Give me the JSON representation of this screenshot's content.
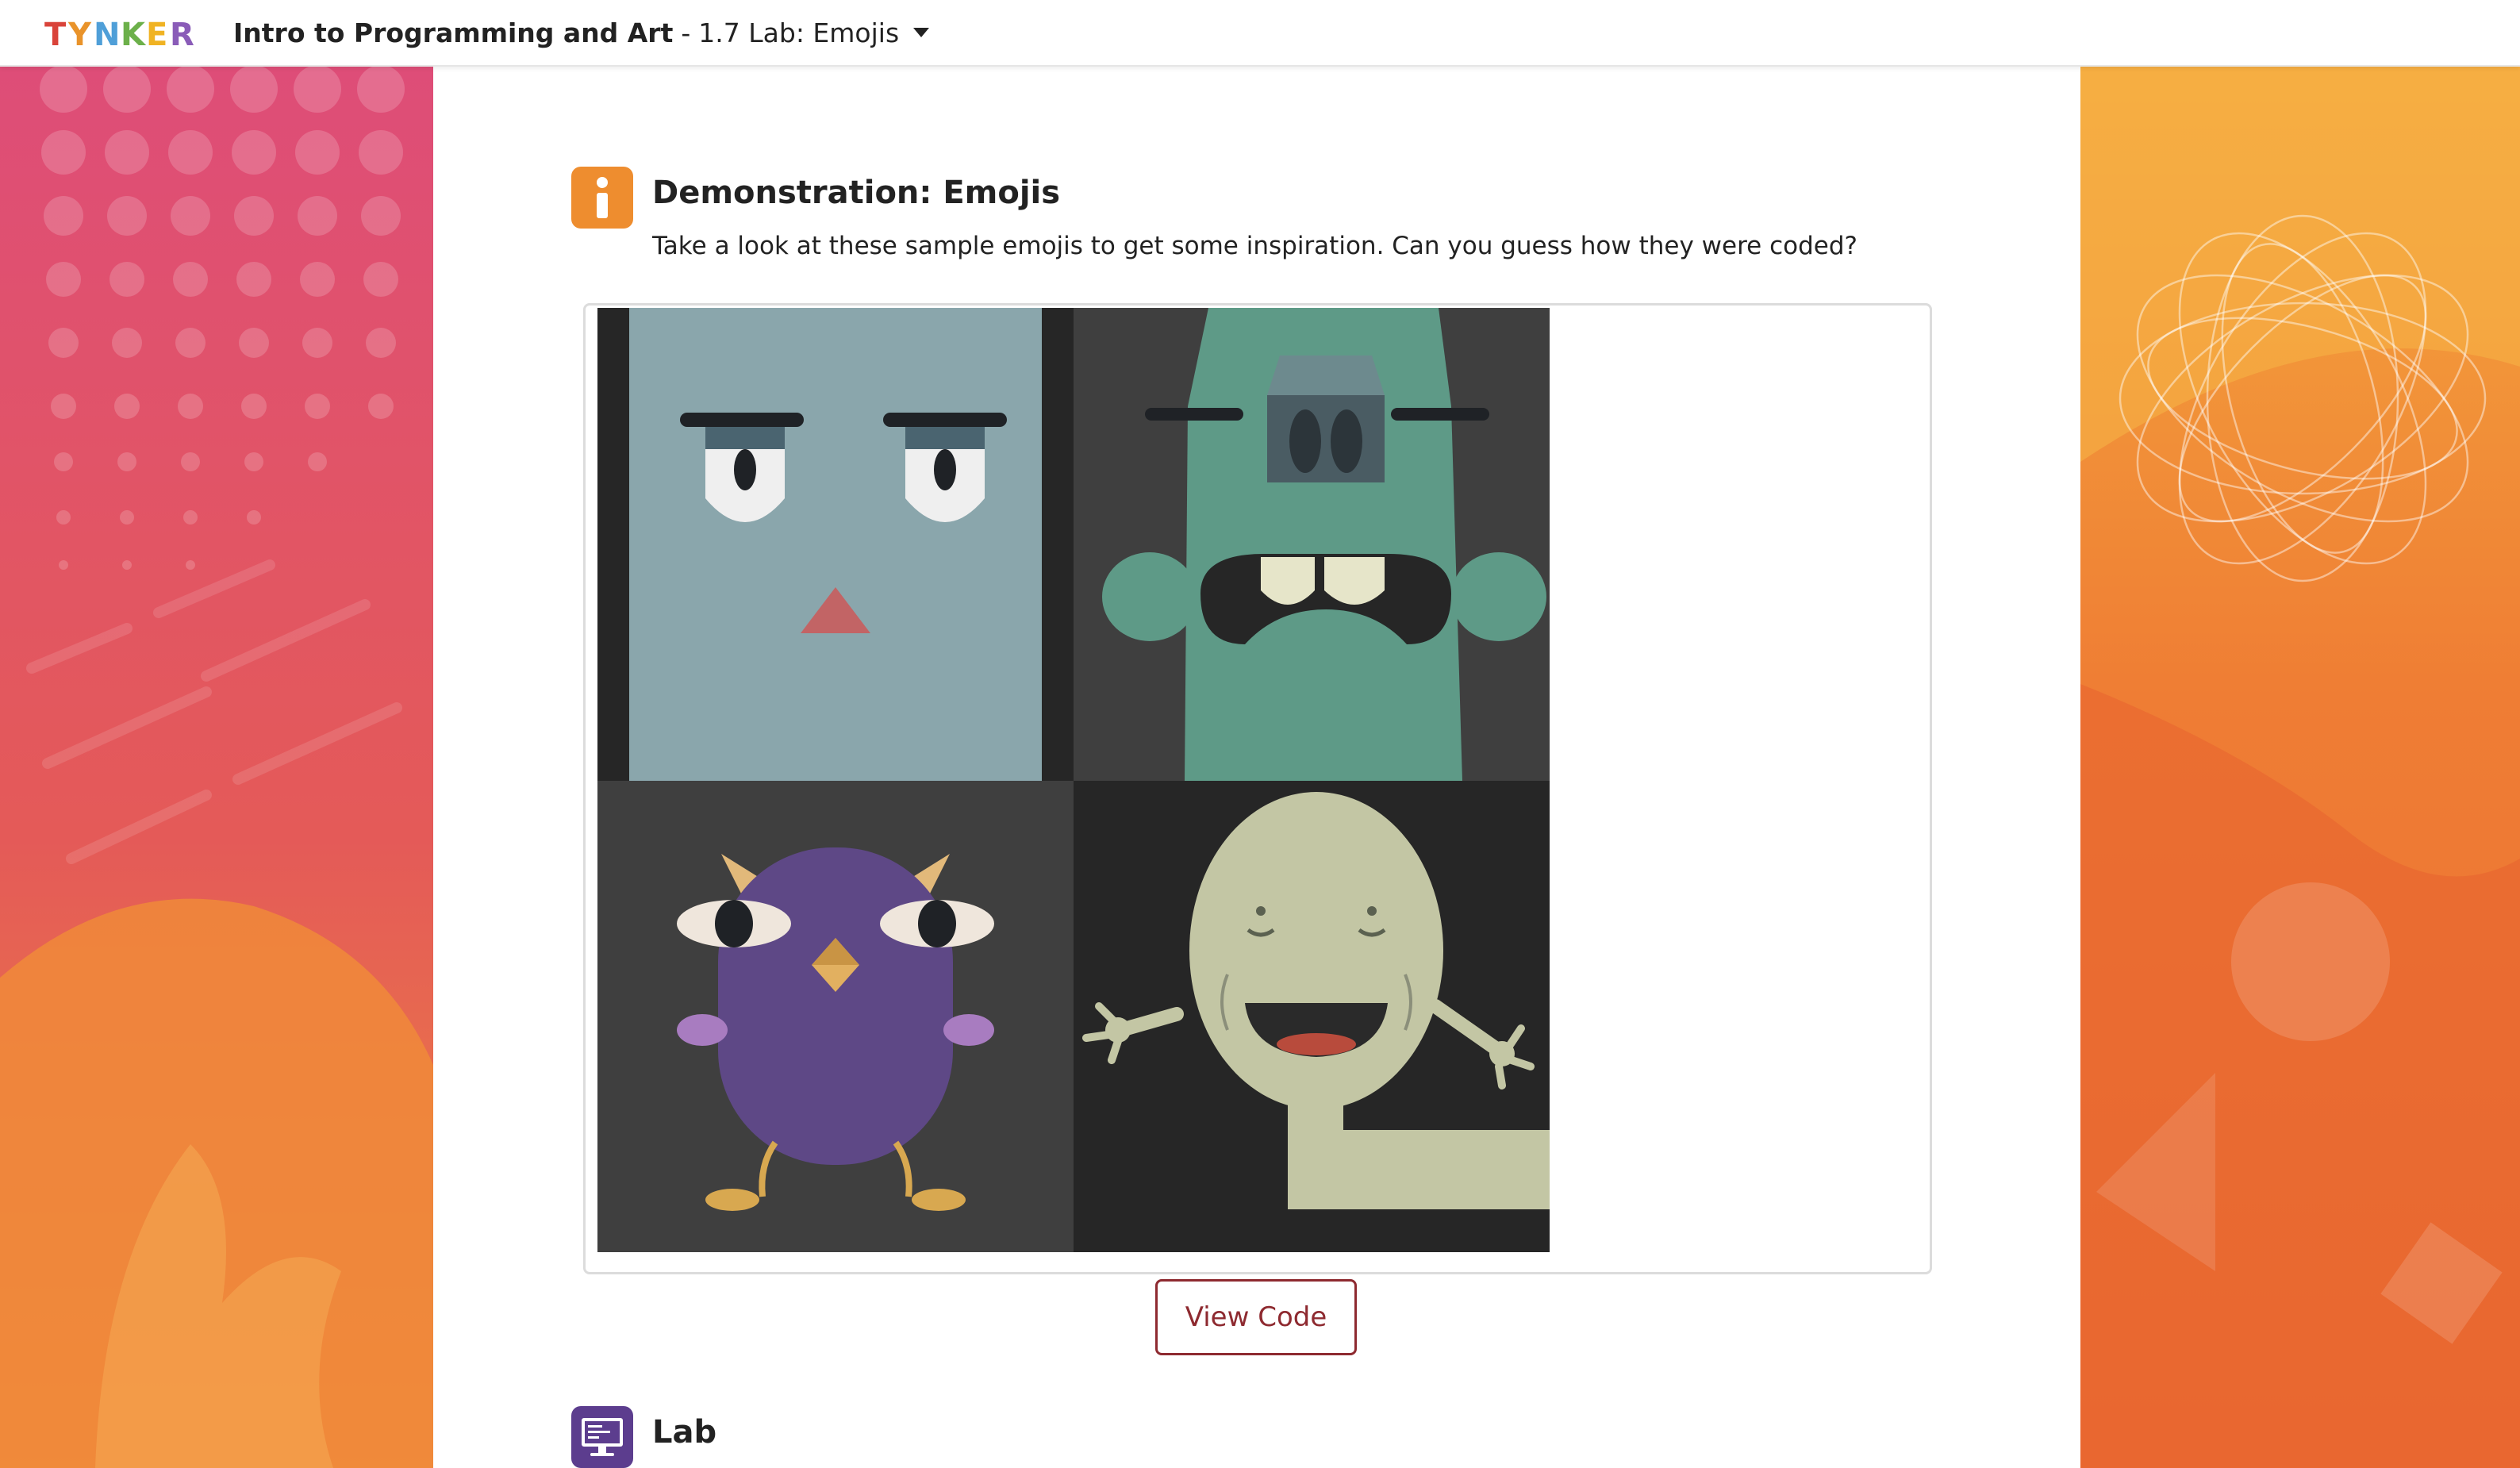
{
  "header": {
    "logo_text": "TYNKER",
    "course_title": "Intro to Programming and Art",
    "separator": "-",
    "lesson_title": "1.7 Lab: Emojis"
  },
  "demo": {
    "icon": "info-icon",
    "title": "Demonstration: Emojis",
    "description": "Take a look at these sample emojis to get some inspiration. Can you guess how they were coded?",
    "image_tiles": [
      "square-face-emoji",
      "green-monster-emoji",
      "purple-owl-emoji",
      "egg-head-emoji"
    ]
  },
  "buttons": {
    "view_code": "View Code"
  },
  "lab": {
    "icon": "computer-icon",
    "title": "Lab"
  },
  "colors": {
    "accent_orange": "#ee8d2f",
    "lab_purple": "#5c3d8e",
    "button_red": "#8e2a30"
  }
}
